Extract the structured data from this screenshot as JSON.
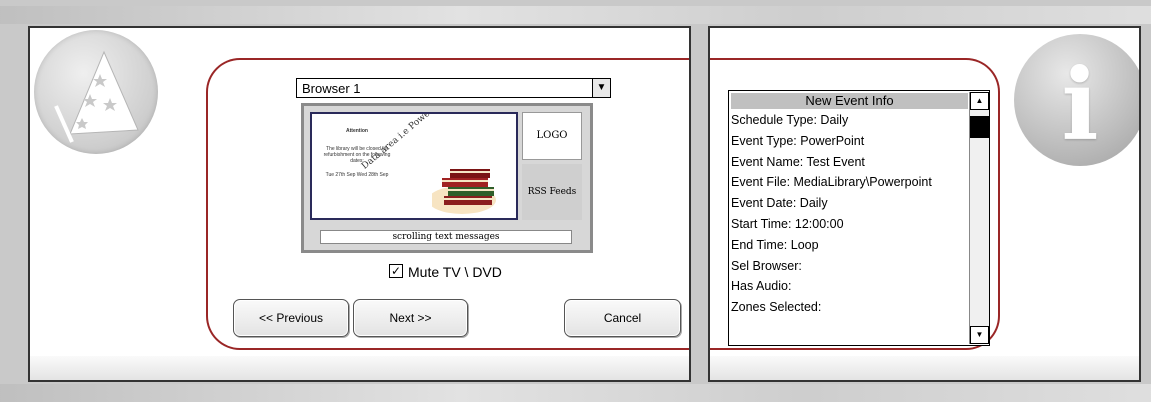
{
  "left_panel": {
    "browser_select": {
      "value": "Browser 1"
    },
    "preview": {
      "data_area_label": "Data area i.e PowerPoint",
      "attention_text": "Attention",
      "notice_text": "The library will be closed for refurbishment on the following dates:",
      "dates_text": "Tue 27th Sep  Wed 28th Sep",
      "logo_label": "LOGO",
      "rss_label": "RSS Feeds",
      "ticker_label": "scrolling text messages"
    },
    "mute": {
      "label": "Mute TV \\ DVD",
      "checked": true
    },
    "buttons": {
      "previous": "<< Previous",
      "next": "Next >>",
      "cancel": "Cancel"
    }
  },
  "right_panel": {
    "info_list": {
      "header": "New Event Info",
      "rows": [
        "Schedule Type: Daily",
        "Event Type: PowerPoint",
        "Event Name: Test Event",
        "Event File: MediaLibrary\\Powerpoint",
        "Event Date: Daily",
        "Start Time: 12:00:00",
        "End Time: Loop",
        "Sel Browser:",
        "Has Audio:",
        "Zones Selected:"
      ]
    }
  },
  "icons": {
    "wizard": "wizard-hat-icon",
    "info": "info-icon",
    "dropdown": "chevron-down-icon"
  },
  "colors": {
    "frame_red": "#9a2626",
    "list_header_bg": "#c0c0c0"
  }
}
